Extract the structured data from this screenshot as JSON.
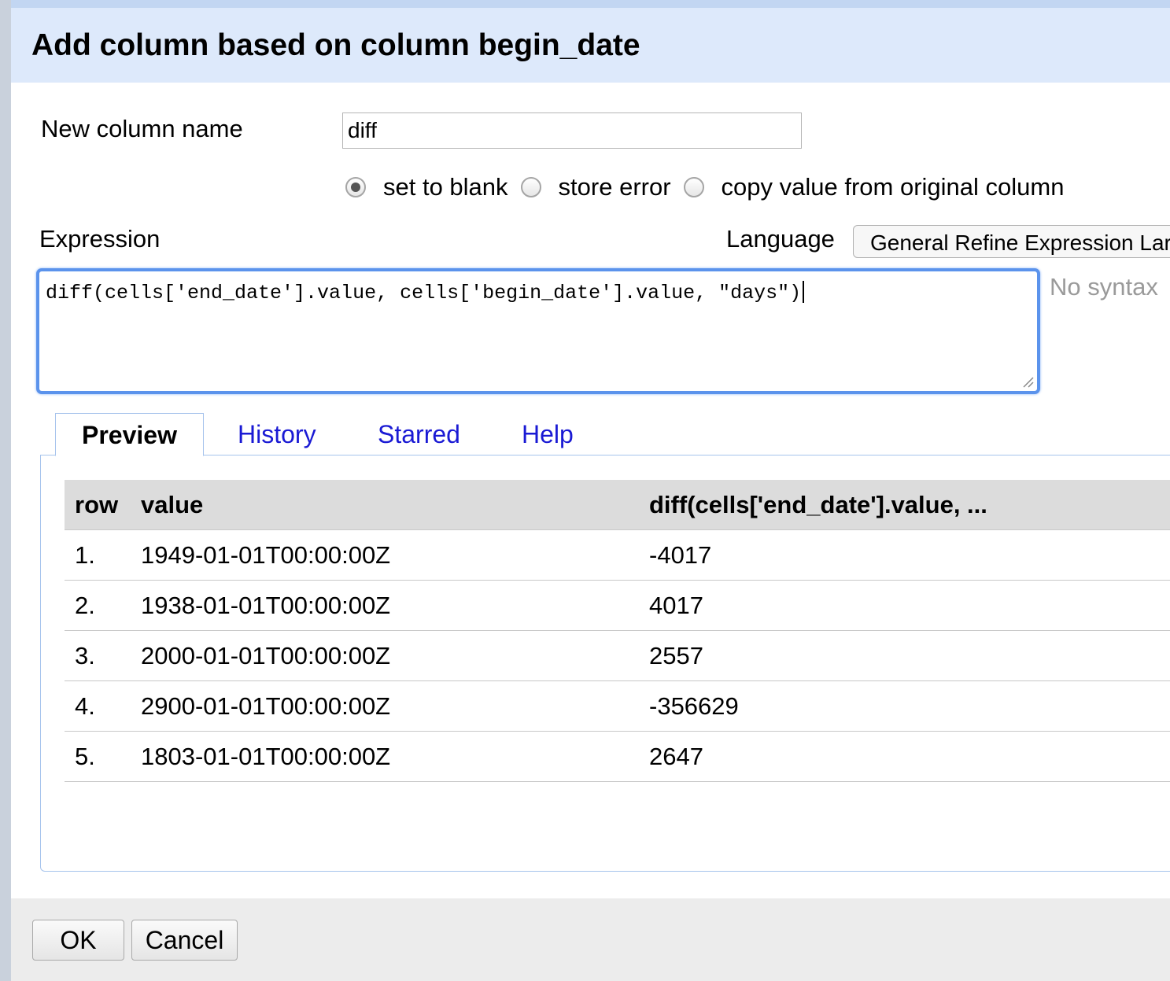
{
  "dialog": {
    "title": "Add column based on column begin_date"
  },
  "new_column": {
    "label": "New column name",
    "value": "diff"
  },
  "on_error": {
    "options": [
      {
        "label": "set to blank",
        "selected": true
      },
      {
        "label": "store error",
        "selected": false
      },
      {
        "label": "copy value from original column",
        "selected": false
      }
    ]
  },
  "expression": {
    "label": "Expression",
    "value": "diff(cells['end_date'].value, cells['begin_date'].value, \"days\")",
    "syntax_status": "No syntax"
  },
  "language": {
    "label": "Language",
    "selected": "General Refine Expression Lar"
  },
  "tabs": [
    {
      "label": "Preview",
      "active": true
    },
    {
      "label": "History",
      "active": false
    },
    {
      "label": "Starred",
      "active": false
    },
    {
      "label": "Help",
      "active": false
    }
  ],
  "preview": {
    "headers": [
      "row",
      "value",
      "diff(cells['end_date'].value, ..."
    ],
    "rows": [
      {
        "row": "1.",
        "value": "1949-01-01T00:00:00Z",
        "result": "-4017"
      },
      {
        "row": "2.",
        "value": "1938-01-01T00:00:00Z",
        "result": "4017"
      },
      {
        "row": "3.",
        "value": "2000-01-01T00:00:00Z",
        "result": "2557"
      },
      {
        "row": "4.",
        "value": "2900-01-01T00:00:00Z",
        "result": "-356629"
      },
      {
        "row": "5.",
        "value": "1803-01-01T00:00:00Z",
        "result": "2647"
      }
    ]
  },
  "buttons": {
    "ok": "OK",
    "cancel": "Cancel"
  },
  "colors": {
    "title_bar": "#dde9fb",
    "expression_focus": "#5b93ec",
    "link": "#1a1ad4",
    "table_header": "#dcdcdc"
  }
}
